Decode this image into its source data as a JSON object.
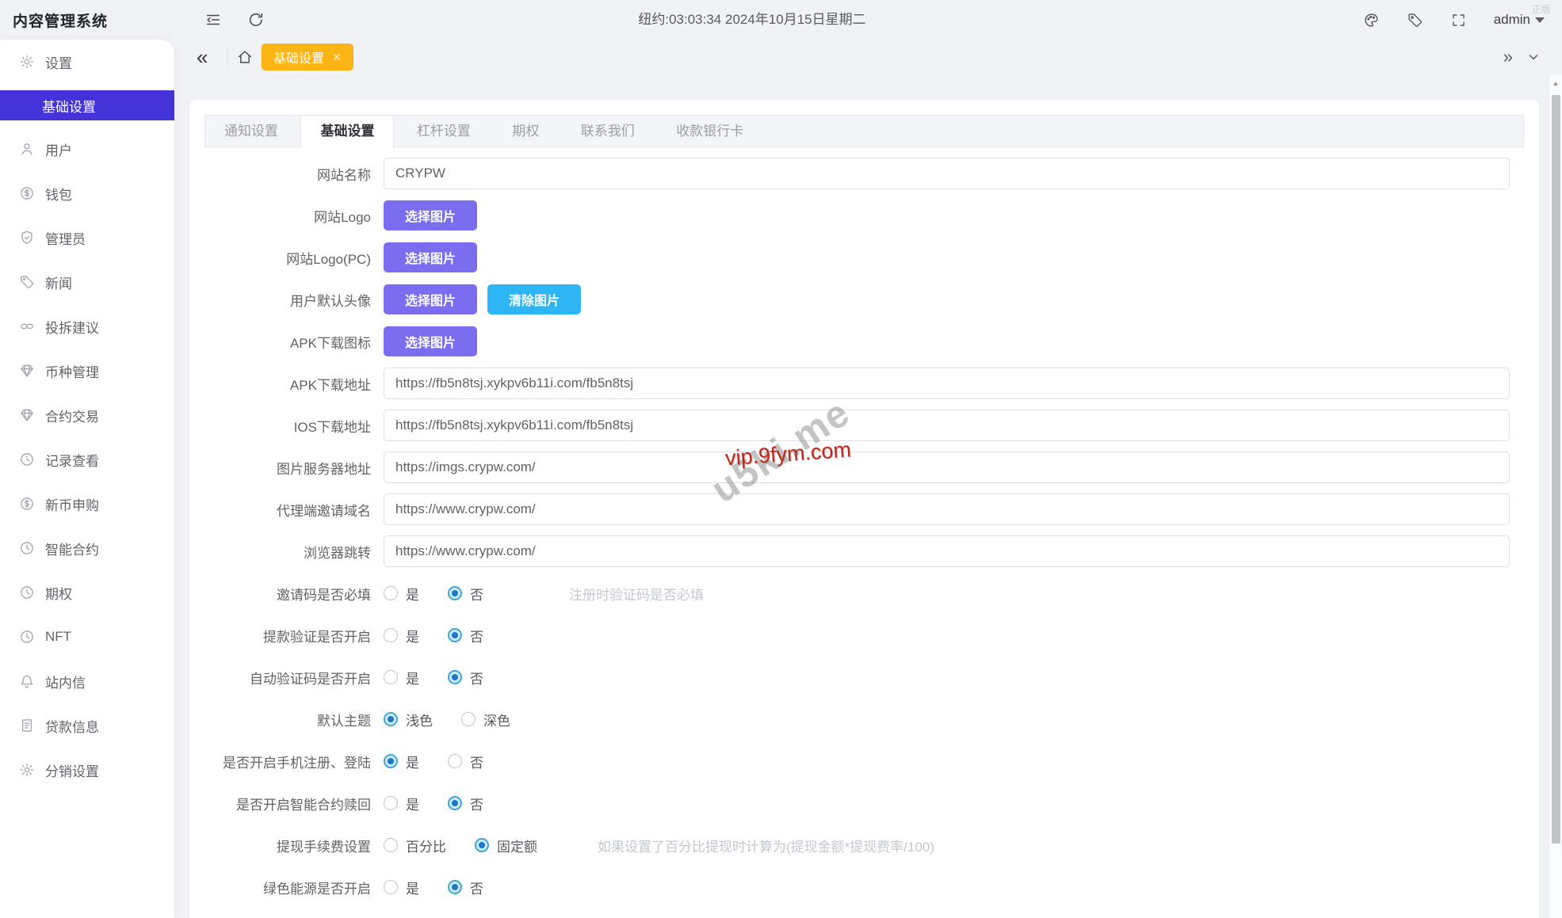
{
  "app": {
    "title": "内容管理系统",
    "corner_mark": "正版"
  },
  "topbar": {
    "time": "纽约:03:03:34 2024年10月15日星期二",
    "user": "admin"
  },
  "tagbar": {
    "active_tag": "基础设置",
    "collapse": "«",
    "expand": "»"
  },
  "sidebar": {
    "items": [
      {
        "label": "设置",
        "icon": "gear-icon"
      },
      {
        "label": "基础设置",
        "icon": null,
        "active": true
      },
      {
        "label": "用户",
        "icon": "user-icon"
      },
      {
        "label": "钱包",
        "icon": "coin-icon"
      },
      {
        "label": "管理员",
        "icon": "shield-icon"
      },
      {
        "label": "新闻",
        "icon": "tag-icon"
      },
      {
        "label": "投拆建议",
        "icon": "link-icon"
      },
      {
        "label": "币种管理",
        "icon": "diamond-icon"
      },
      {
        "label": "合约交易",
        "icon": "diamond-icon"
      },
      {
        "label": "记录查看",
        "icon": "history-icon"
      },
      {
        "label": "新币申购",
        "icon": "coin-icon"
      },
      {
        "label": "智能合约",
        "icon": "history-icon"
      },
      {
        "label": "期权",
        "icon": "history-icon"
      },
      {
        "label": "NFT",
        "icon": "history-icon"
      },
      {
        "label": "站内信",
        "icon": "bell-icon"
      },
      {
        "label": "贷款信息",
        "icon": "doc-icon"
      },
      {
        "label": "分销设置",
        "icon": "gear-icon"
      }
    ]
  },
  "tabs": [
    {
      "label": "通知设置"
    },
    {
      "label": "基础设置",
      "active": true
    },
    {
      "label": "杠杆设置"
    },
    {
      "label": "期权"
    },
    {
      "label": "联系我们"
    },
    {
      "label": "收款银行卡"
    }
  ],
  "form": {
    "buttons": {
      "select": "选择图片",
      "clear": "清除图片"
    },
    "fields": [
      {
        "label": "网站名称",
        "type": "input",
        "value": "CRYPW"
      },
      {
        "label": "网站Logo",
        "type": "button"
      },
      {
        "label": "网站Logo(PC)",
        "type": "button"
      },
      {
        "label": "用户默认头像",
        "type": "button-pair"
      },
      {
        "label": "APK下载图标",
        "type": "button"
      },
      {
        "label": "APK下载地址",
        "type": "input",
        "value": "https://fb5n8tsj.xykpv6b11i.com/fb5n8tsj"
      },
      {
        "label": "IOS下载地址",
        "type": "input",
        "value": "https://fb5n8tsj.xykpv6b11i.com/fb5n8tsj"
      },
      {
        "label": "图片服务器地址",
        "type": "input",
        "value": "https://imgs.crypw.com/"
      },
      {
        "label": "代理端邀请域名",
        "type": "input",
        "value": "https://www.crypw.com/"
      },
      {
        "label": "浏览器跳转",
        "type": "input",
        "value": "https://www.crypw.com/"
      },
      {
        "label": "邀请码是否必填",
        "type": "radio",
        "options": [
          "是",
          "否"
        ],
        "selected": "否",
        "hint": "注册时验证码是否必填"
      },
      {
        "label": "提款验证是否开启",
        "type": "radio",
        "options": [
          "是",
          "否"
        ],
        "selected": "否"
      },
      {
        "label": "自动验证码是否开启",
        "type": "radio",
        "options": [
          "是",
          "否"
        ],
        "selected": "否"
      },
      {
        "label": "默认主题",
        "type": "radio",
        "options": [
          "浅色",
          "深色"
        ],
        "selected": "浅色"
      },
      {
        "label": "是否开启手机注册、登陆",
        "type": "radio",
        "options": [
          "是",
          "否"
        ],
        "selected": "是"
      },
      {
        "label": "是否开启智能合约赎回",
        "type": "radio",
        "options": [
          "是",
          "否"
        ],
        "selected": "否"
      },
      {
        "label": "提现手续费设置",
        "type": "radio",
        "options": [
          "百分比",
          "固定额"
        ],
        "selected": "固定额",
        "hint": "如果设置了百分比提现时计算为(提现金额*提现费率/100)"
      },
      {
        "label": "绿色能源是否开启",
        "type": "radio",
        "options": [
          "是",
          "否"
        ],
        "selected": "否"
      }
    ]
  },
  "watermarks": {
    "red": "vip.9fym.com",
    "gray": "u5ki.me"
  },
  "colors": {
    "accent_purple": "#4433d9",
    "button_purple": "#7a6df0",
    "button_blue": "#2db5f5",
    "tag_yellow": "#fdb515",
    "radio_blue": "#1e78c8"
  }
}
